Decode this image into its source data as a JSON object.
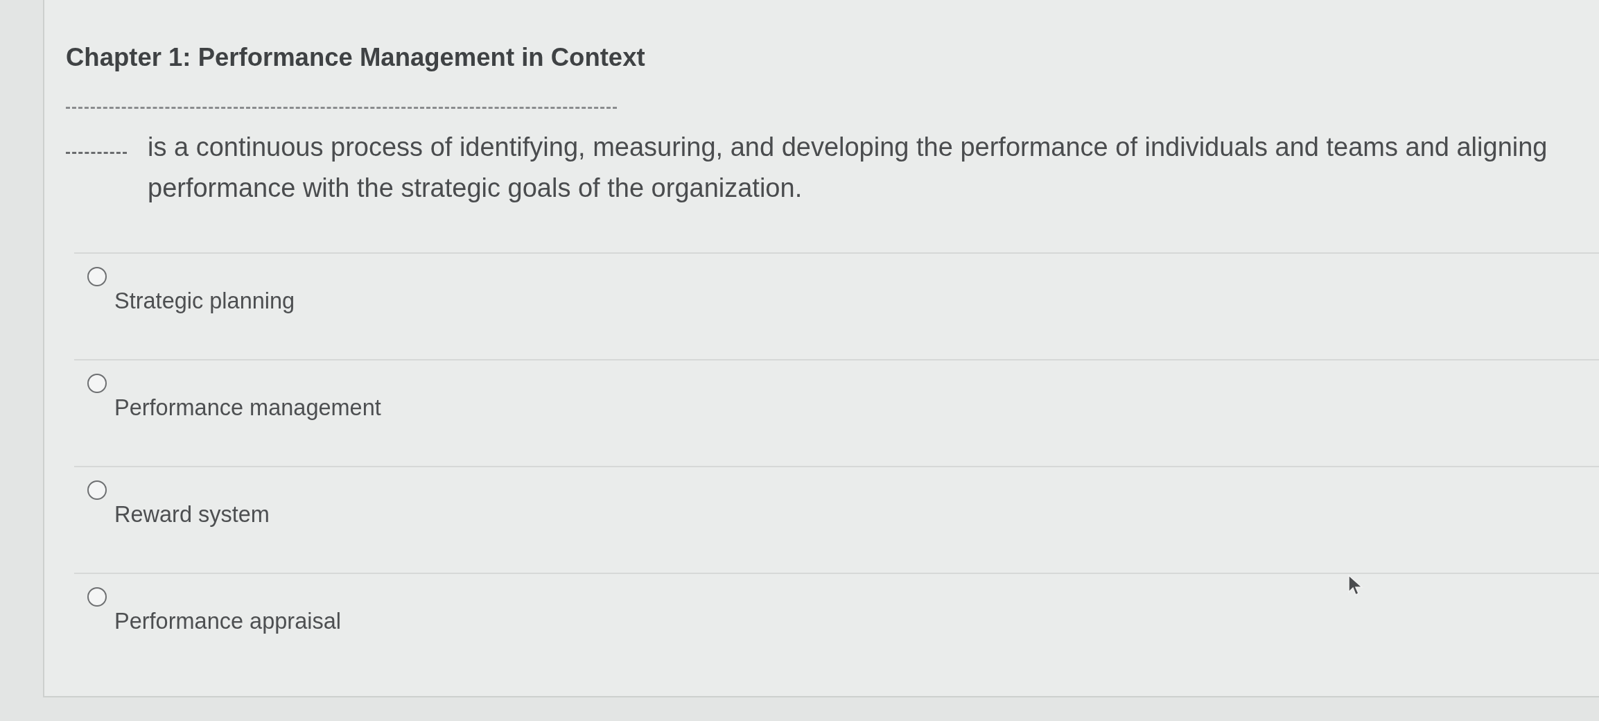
{
  "header": {
    "title": "Chapter 1: Performance Management in Context"
  },
  "question": {
    "text": "is a continuous process of identifying, measuring, and developing the performance of individuals and teams and aligning performance with the strategic goals of the organization."
  },
  "options": [
    {
      "label": "Strategic planning",
      "selected": false
    },
    {
      "label": "Performance management",
      "selected": false
    },
    {
      "label": "Reward system",
      "selected": false
    },
    {
      "label": "Performance appraisal",
      "selected": false
    }
  ]
}
